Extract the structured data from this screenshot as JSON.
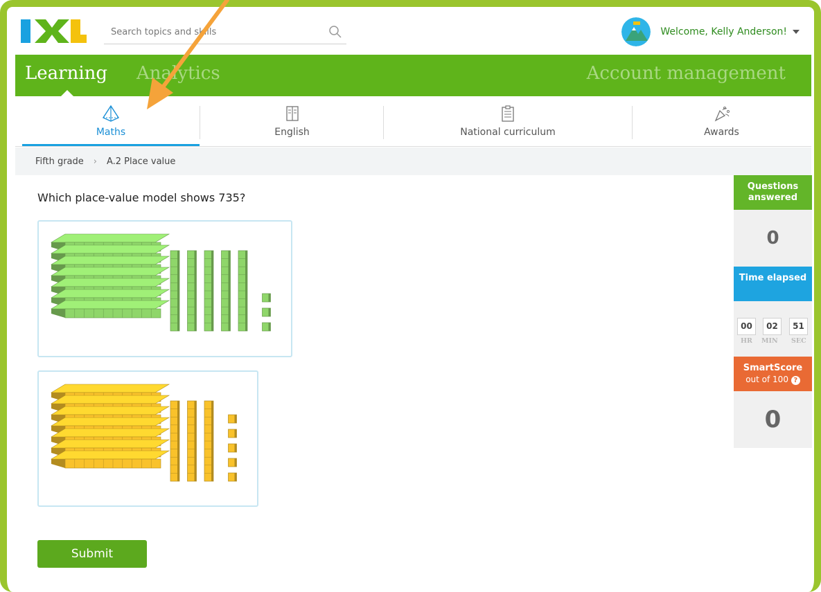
{
  "header": {
    "search_placeholder": "Search topics and skills",
    "welcome": "Welcome, Kelly Anderson!"
  },
  "nav": {
    "learning": "Learning",
    "analytics": "Analytics",
    "account": "Account management"
  },
  "tabs": [
    {
      "label": "Maths",
      "icon": "pyramid-icon",
      "active": true
    },
    {
      "label": "English",
      "icon": "book-icon"
    },
    {
      "label": "National curriculum",
      "icon": "clipboard-icon"
    },
    {
      "label": "Awards",
      "icon": "party-popper-icon"
    }
  ],
  "breadcrumb": {
    "grade": "Fifth grade",
    "skill": "A.2 Place value"
  },
  "question": {
    "text": "Which place-value model shows 735?",
    "choices": [
      {
        "color": "#8fd66a",
        "hundreds": 7,
        "tens": 5,
        "ones": 3
      },
      {
        "color": "#f9c22b",
        "hundreds": 7,
        "tens": 3,
        "ones": 5
      }
    ],
    "submit_label": "Submit"
  },
  "sidepanel": {
    "questions_label": "Questions answered",
    "questions_value": "0",
    "time_label": "Time elapsed",
    "time": {
      "hr": "00",
      "min": "02",
      "sec": "51"
    },
    "time_units": {
      "hr": "HR",
      "min": "MIN",
      "sec": "SEC"
    },
    "smartscore_label": "SmartScore",
    "smartscore_sub": "out of 100",
    "smartscore_value": "0"
  },
  "colors": {
    "brand_green": "#5fb41b",
    "accent_blue": "#1ea4e0",
    "smartscore_orange": "#e96a34",
    "annotation_arrow": "#f5a33a"
  }
}
